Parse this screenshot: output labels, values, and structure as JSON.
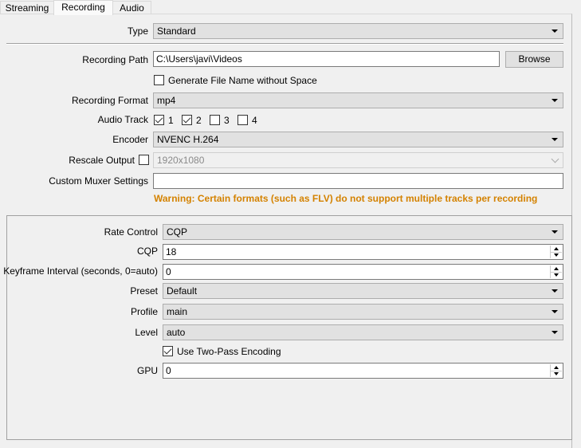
{
  "tabs": [
    "Streaming",
    "Recording",
    "Audio"
  ],
  "type": {
    "label": "Type",
    "value": "Standard"
  },
  "path": {
    "label": "Recording Path",
    "value": "C:\\Users\\javi\\Videos",
    "browse": "Browse"
  },
  "gen_no_space": {
    "label": "Generate File Name without Space",
    "checked": false
  },
  "format": {
    "label": "Recording Format",
    "value": "mp4"
  },
  "audio_track": {
    "label": "Audio Track",
    "tracks": [
      {
        "label": "1",
        "checked": true
      },
      {
        "label": "2",
        "checked": true
      },
      {
        "label": "3",
        "checked": false
      },
      {
        "label": "4",
        "checked": false
      }
    ]
  },
  "encoder": {
    "label": "Encoder",
    "value": "NVENC H.264"
  },
  "rescale": {
    "label": "Rescale Output",
    "checked": false,
    "value": "1920x1080"
  },
  "muxer": {
    "label": "Custom Muxer Settings",
    "value": ""
  },
  "warning": "Warning: Certain formats (such as FLV) do not support multiple tracks per recording",
  "enc": {
    "rate_control": {
      "label": "Rate Control",
      "value": "CQP"
    },
    "cqp": {
      "label": "CQP",
      "value": "18"
    },
    "keyframe": {
      "label": "Keyframe Interval (seconds, 0=auto)",
      "value": "0"
    },
    "preset": {
      "label": "Preset",
      "value": "Default"
    },
    "profile": {
      "label": "Profile",
      "value": "main"
    },
    "level": {
      "label": "Level",
      "value": "auto"
    },
    "two_pass": {
      "label": "Use Two-Pass Encoding",
      "checked": true
    },
    "gpu": {
      "label": "GPU",
      "value": "0"
    }
  }
}
